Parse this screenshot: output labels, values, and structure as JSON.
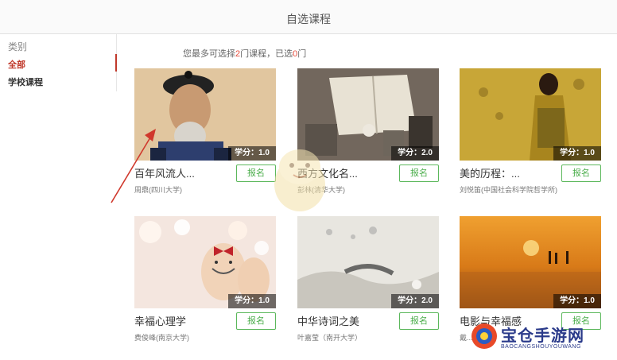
{
  "header": {
    "title": "自选课程"
  },
  "sidebar": {
    "heading": "类别",
    "items": [
      {
        "label": "全部",
        "active": true
      },
      {
        "label": "学校课程",
        "active": false
      }
    ]
  },
  "notice": {
    "prefix": "您最多可选择",
    "max": "2",
    "middle": "门课程，已选",
    "selected": "0",
    "suffix": "门"
  },
  "courses": [
    {
      "title": "百年风流人...",
      "teacher": "周鼎(四川大学)",
      "credit": "学分：1.0",
      "enroll": "报名"
    },
    {
      "title": "西方文化名...",
      "teacher": "彭林(清华大学)",
      "credit": "学分：2.0",
      "enroll": "报名"
    },
    {
      "title": "美的历程：...",
      "teacher": "刘悦笛(中国社会科学院哲学所)",
      "credit": "学分：1.0",
      "enroll": "报名"
    },
    {
      "title": "幸福心理学",
      "teacher": "费俊峰(南京大学)",
      "credit": "学分：1.0",
      "enroll": "报名"
    },
    {
      "title": "中华诗词之美",
      "teacher": "叶嘉莹（南开大学）",
      "credit": "学分：2.0",
      "enroll": "报名"
    },
    {
      "title": "电影与幸福感",
      "teacher": "戴...",
      "credit": "学分：1.0",
      "enroll": "报名"
    }
  ],
  "watermark": {
    "name": "宝仓手游网",
    "sub": "BAOCANGSHOUYOUWANG"
  },
  "colors": {
    "accent": "#c0392b",
    "count": "#e74c3c",
    "button": "#5cb85c"
  }
}
